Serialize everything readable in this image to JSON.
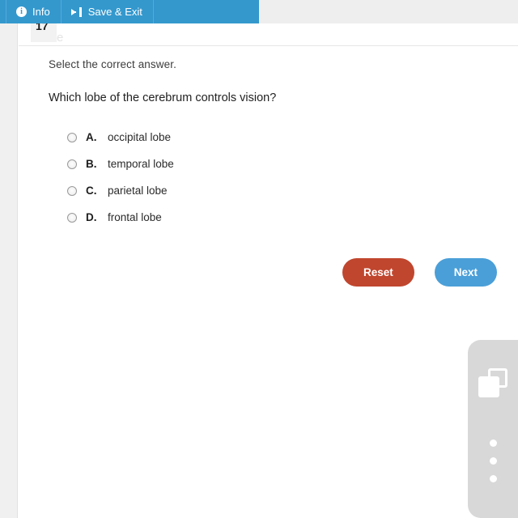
{
  "toolbar": {
    "items": [
      {
        "label": "Info",
        "icon": "info-circle-icon"
      },
      {
        "label": "Save & Exit",
        "icon": "sign-out-icon"
      }
    ]
  },
  "header": {
    "question_number": "17",
    "ghost_text": "Se"
  },
  "main": {
    "instruction": "Select the correct answer.",
    "question": "Which lobe of the cerebrum controls vision?",
    "options": [
      {
        "letter": "A.",
        "text": "occipital lobe",
        "selected": false
      },
      {
        "letter": "B.",
        "text": "temporal lobe",
        "selected": false
      },
      {
        "letter": "C.",
        "text": "parietal lobe",
        "selected": false
      },
      {
        "letter": "D.",
        "text": "frontal lobe",
        "selected": false
      }
    ],
    "buttons": {
      "reset_label": "Reset",
      "next_label": "Next"
    }
  },
  "side_widget": {
    "copy_icon": "copy-windows-icon",
    "more_icon": "more-vertical-dots-icon"
  },
  "colors": {
    "toolbar_blue": "#3498cd",
    "next_blue": "#4a9fd8",
    "reset_red": "#c0462e",
    "widget_gray": "#d8d8d8"
  }
}
